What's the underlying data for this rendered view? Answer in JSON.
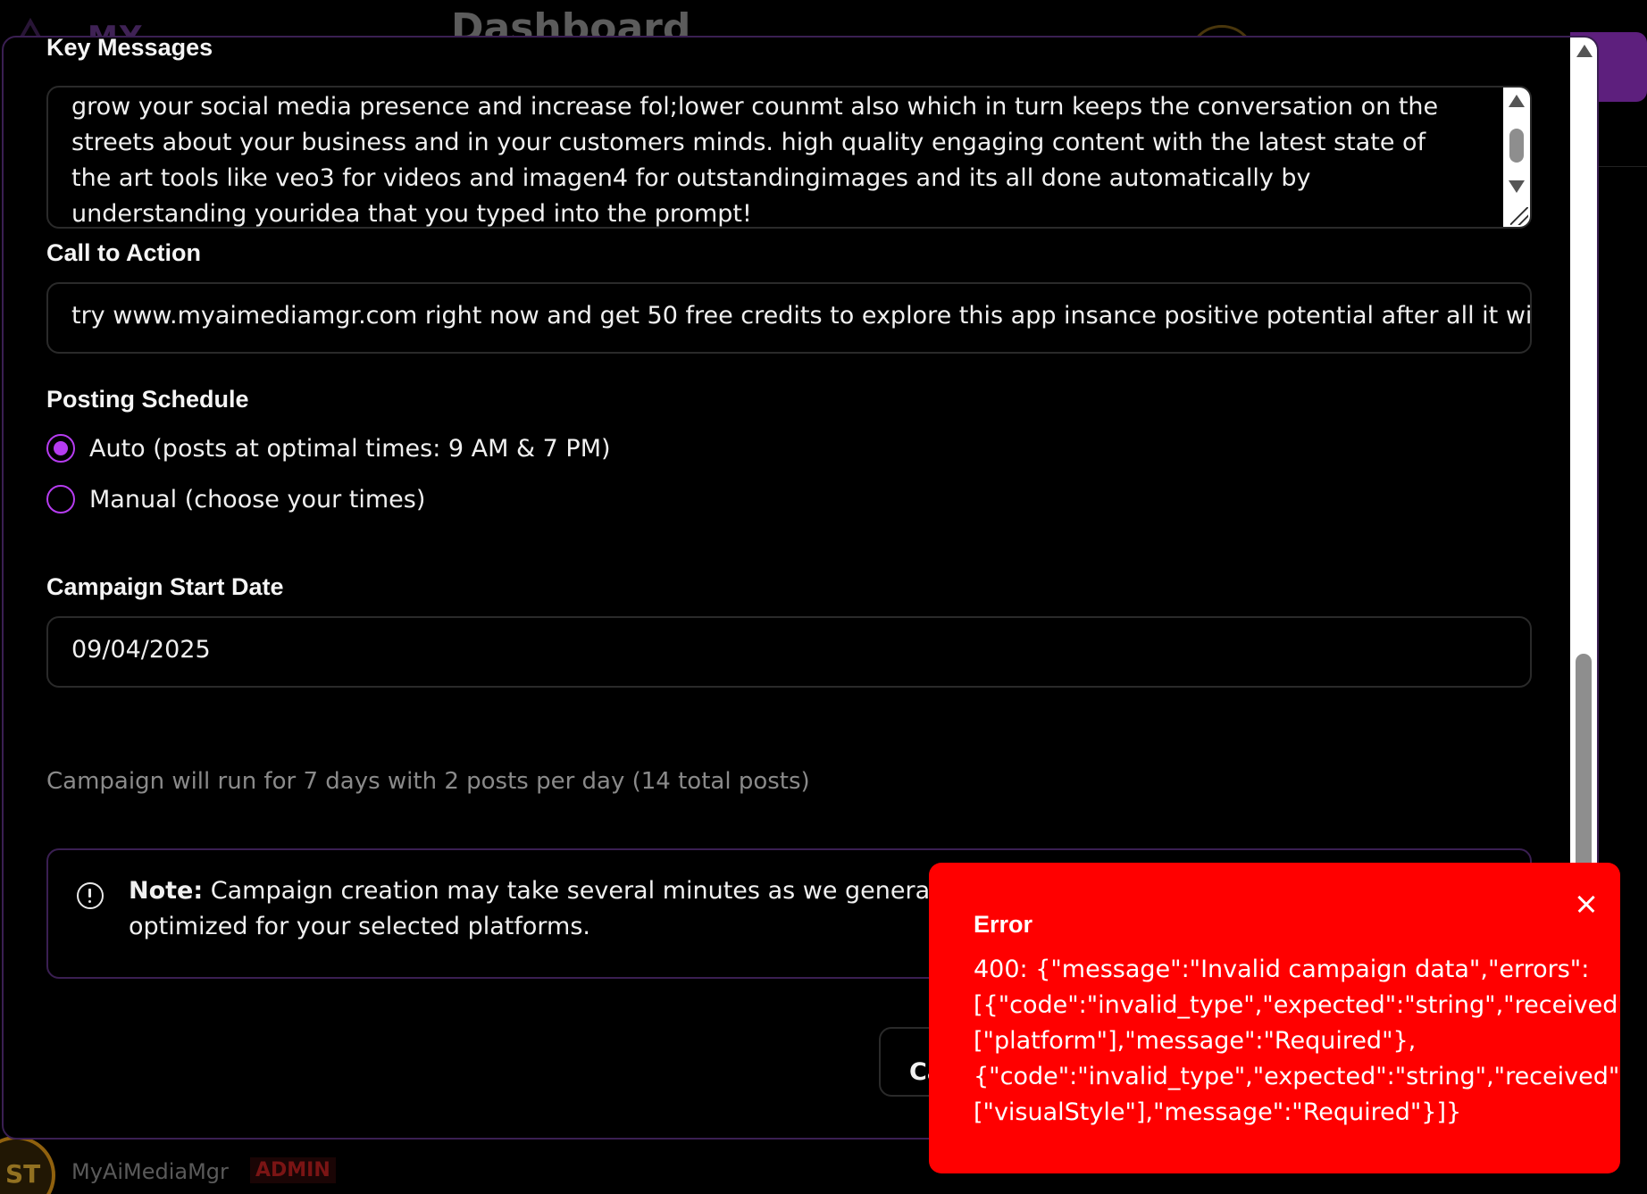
{
  "background": {
    "logo_text": "MY",
    "page_title": "Dashboard",
    "user": {
      "initials": "ST",
      "name": "MyAiMediaMgr",
      "role_badge": "ADMIN"
    }
  },
  "form": {
    "key_messages": {
      "label": "Key Messages",
      "value": "grow your social media presence and increase fol;lower counmt also which in turn keeps the conversation on the\nstreets about your business and in your customers minds. high quality engaging content with the latest state of\nthe art tools like veo3 for videos and imagen4 for outstandingimages and its all done automatically by\nunderstanding youridea that you typed into the prompt!"
    },
    "call_to_action": {
      "label": "Call to Action",
      "value": "try www.myaimediamgr.com right now and get 50 free credits to explore this app insance positive potential after all it will"
    },
    "posting_schedule": {
      "label": "Posting Schedule",
      "options": [
        {
          "label": "Auto (posts at optimal times: 9 AM & 7 PM)",
          "selected": true
        },
        {
          "label": "Manual (choose your times)",
          "selected": false
        }
      ]
    },
    "start_date": {
      "label": "Campaign Start Date",
      "value": "09/04/2025",
      "helper": "Campaign will run for 7 days with 2 posts per day (14 total posts)"
    },
    "note": {
      "bold": "Note:",
      "text": " Campaign creation may take several minutes as we generate\noptimized for your selected platforms."
    },
    "cancel_label": "Ca"
  },
  "toast": {
    "title": "Error",
    "message": "400: {\"message\":\"Invalid campaign data\",\"errors\":\n[{\"code\":\"invalid_type\",\"expected\":\"string\",\"received\"\n[\"platform\"],\"message\":\"Required\"},\n{\"code\":\"invalid_type\",\"expected\":\"string\",\"received\":\n[\"visualStyle\"],\"message\":\"Required\"}]}"
  },
  "colors": {
    "accent": "#b63cf0",
    "error_bg": "#ff0000",
    "border": "#2a2a2a",
    "note_border": "#3a1f52"
  }
}
